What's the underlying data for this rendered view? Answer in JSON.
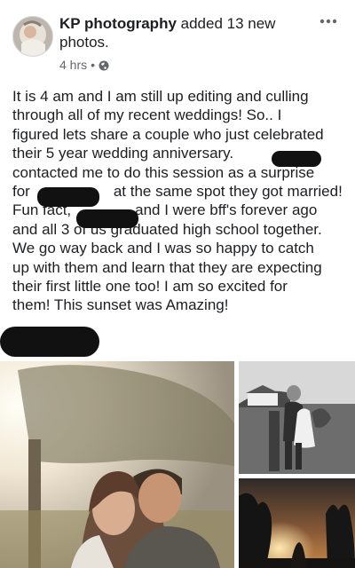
{
  "post": {
    "author": "KP photography",
    "action_text": " added 13 new photos.",
    "time": "4 hrs",
    "separator": "•",
    "privacy_icon": "globe-icon",
    "more_icon": "more-options-icon",
    "body_lines": [
      "It is 4 am and I am still up editing and culling",
      "through all of my recent weddings! So.. I",
      "figured lets share a couple who just celebrated",
      "their 5 year wedding anniversary.",
      "contacted me to do this session as a surprise",
      "for",
      "at the same spot they got married!",
      "Fun fact,",
      "and I were bff's forever ago",
      "and all 3 of us graduated high school together.",
      "We go way back and I was so happy to catch",
      "up with them and learn that they are expecting",
      "their first little one too! I am so excited for",
      "them! This sunset was Amazing!"
    ]
  },
  "photos": [
    {
      "subject": "couple embracing under tree at sunset"
    },
    {
      "subject": "black and white couple kissing in field"
    },
    {
      "subject": "silhouette at sunset with trees"
    }
  ]
}
